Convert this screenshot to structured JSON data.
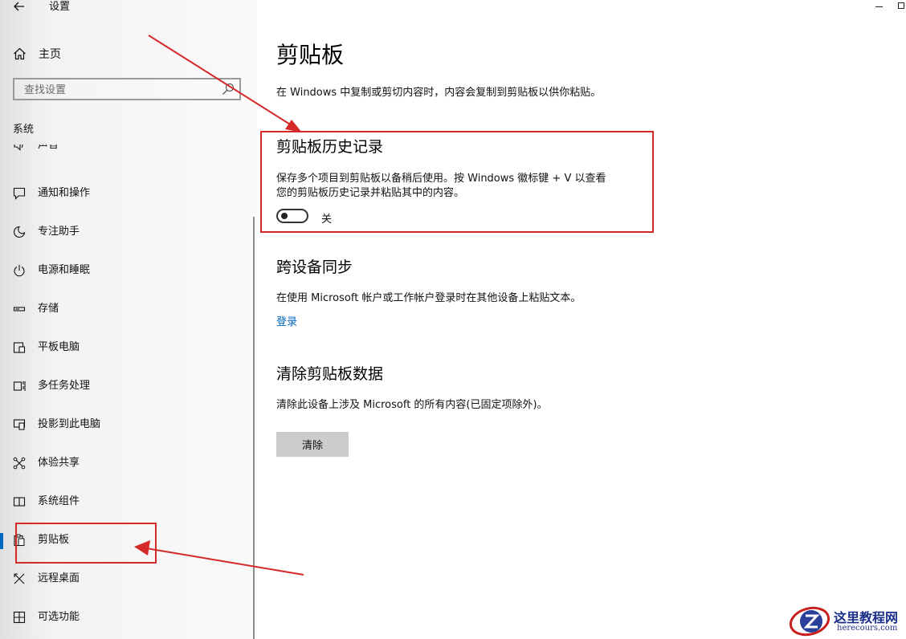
{
  "window": {
    "title": "设置"
  },
  "sidebar": {
    "home_label": "主页",
    "search_placeholder": "查找设置",
    "section_title": "系统",
    "items": [
      {
        "label": "声音",
        "icon": "speaker-icon",
        "selected": false
      },
      {
        "label": "通知和操作",
        "icon": "notification-icon",
        "selected": false
      },
      {
        "label": "专注助手",
        "icon": "moon-icon",
        "selected": false
      },
      {
        "label": "电源和睡眠",
        "icon": "power-icon",
        "selected": false
      },
      {
        "label": "存储",
        "icon": "storage-icon",
        "selected": false
      },
      {
        "label": "平板电脑",
        "icon": "tablet-icon",
        "selected": false
      },
      {
        "label": "多任务处理",
        "icon": "multitasking-icon",
        "selected": false
      },
      {
        "label": "投影到此电脑",
        "icon": "projection-icon",
        "selected": false
      },
      {
        "label": "体验共享",
        "icon": "share-icon",
        "selected": false
      },
      {
        "label": "系统组件",
        "icon": "components-icon",
        "selected": false
      },
      {
        "label": "剪贴板",
        "icon": "clipboard-icon",
        "selected": true
      },
      {
        "label": "远程桌面",
        "icon": "remote-desktop-icon",
        "selected": false
      },
      {
        "label": "可选功能",
        "icon": "optional-features-icon",
        "selected": false
      }
    ]
  },
  "main": {
    "title": "剪贴板",
    "description": "在 Windows 中复制或剪切内容时，内容会复制到剪贴板以供你粘贴。",
    "history": {
      "title": "剪贴板历史记录",
      "text_line1": "保存多个项目到剪贴板以备稍后使用。按 Windows 徽标键 + V 以查看",
      "text_line2": "您的剪贴板历史记录并粘贴其中的内容。",
      "toggle_state": "关",
      "toggle_on": false
    },
    "sync": {
      "title": "跨设备同步",
      "text": "在使用 Microsoft 帐户或工作帐户登录时在其他设备上粘贴文本。",
      "link": "登录"
    },
    "clear": {
      "title": "清除剪贴板数据",
      "text": "清除此设备上涉及 Microsoft 的所有内容(已固定项除外)。",
      "button": "清除"
    }
  },
  "annotations": {
    "color": "#d42a2a"
  },
  "watermark": {
    "title": "这里教程网",
    "url": "herecours.com"
  },
  "colors": {
    "accent": "#0067c0",
    "button_bg": "#cccccc"
  }
}
